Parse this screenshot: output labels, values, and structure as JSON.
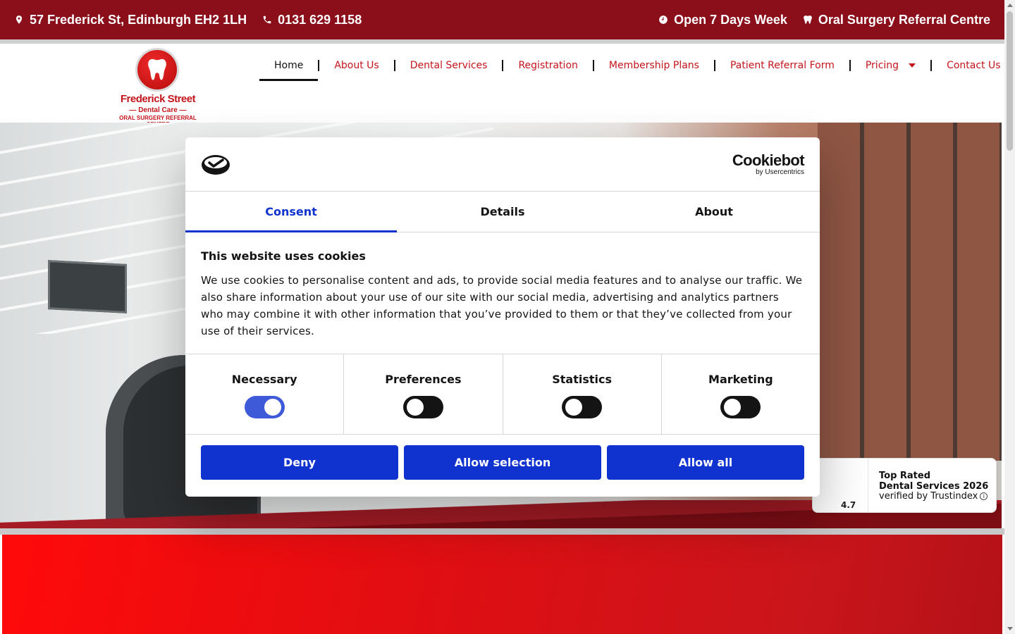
{
  "topbar": {
    "address": "57 Frederick St, Edinburgh EH2 1LH",
    "phone": "0131 629 1158",
    "hours": "Open 7 Days Week",
    "referral": "Oral Surgery Referral Centre"
  },
  "logo": {
    "line1": "Frederick Street",
    "line2": "— Dental Care —",
    "line3": "ORAL SURGERY REFERRAL CENTRE"
  },
  "nav": {
    "items": [
      {
        "label": "Home"
      },
      {
        "label": "About Us"
      },
      {
        "label": "Dental Services"
      },
      {
        "label": "Registration"
      },
      {
        "label": "Membership Plans"
      },
      {
        "label": "Patient Referral Form"
      },
      {
        "label": "Pricing"
      },
      {
        "label": "Contact Us"
      }
    ]
  },
  "cookie": {
    "brand": "Cookiebot",
    "brand_sub": "by Usercentrics",
    "tabs": [
      "Consent",
      "Details",
      "About"
    ],
    "title": "This website uses cookies",
    "body": "We use cookies to personalise content and ads, to provide social media features and to analyse our traffic. We also share information about your use of our site with our social media, advertising and analytics partners who may combine it with other information that you’ve provided to them or that they’ve collected from your use of their services.",
    "toggles": [
      {
        "label": "Necessary",
        "on": true
      },
      {
        "label": "Preferences",
        "on": false
      },
      {
        "label": "Statistics",
        "on": false
      },
      {
        "label": "Marketing",
        "on": false
      }
    ],
    "buttons": {
      "deny": "Deny",
      "selection": "Allow selection",
      "all": "Allow all"
    }
  },
  "badge": {
    "rating": "4.7",
    "line1": "Top Rated",
    "line2": "Dental Services 2026",
    "line3": "verified by Trustindex"
  },
  "colors": {
    "brand_red": "#8a0f1b",
    "accent_blue": "#1032cf"
  }
}
